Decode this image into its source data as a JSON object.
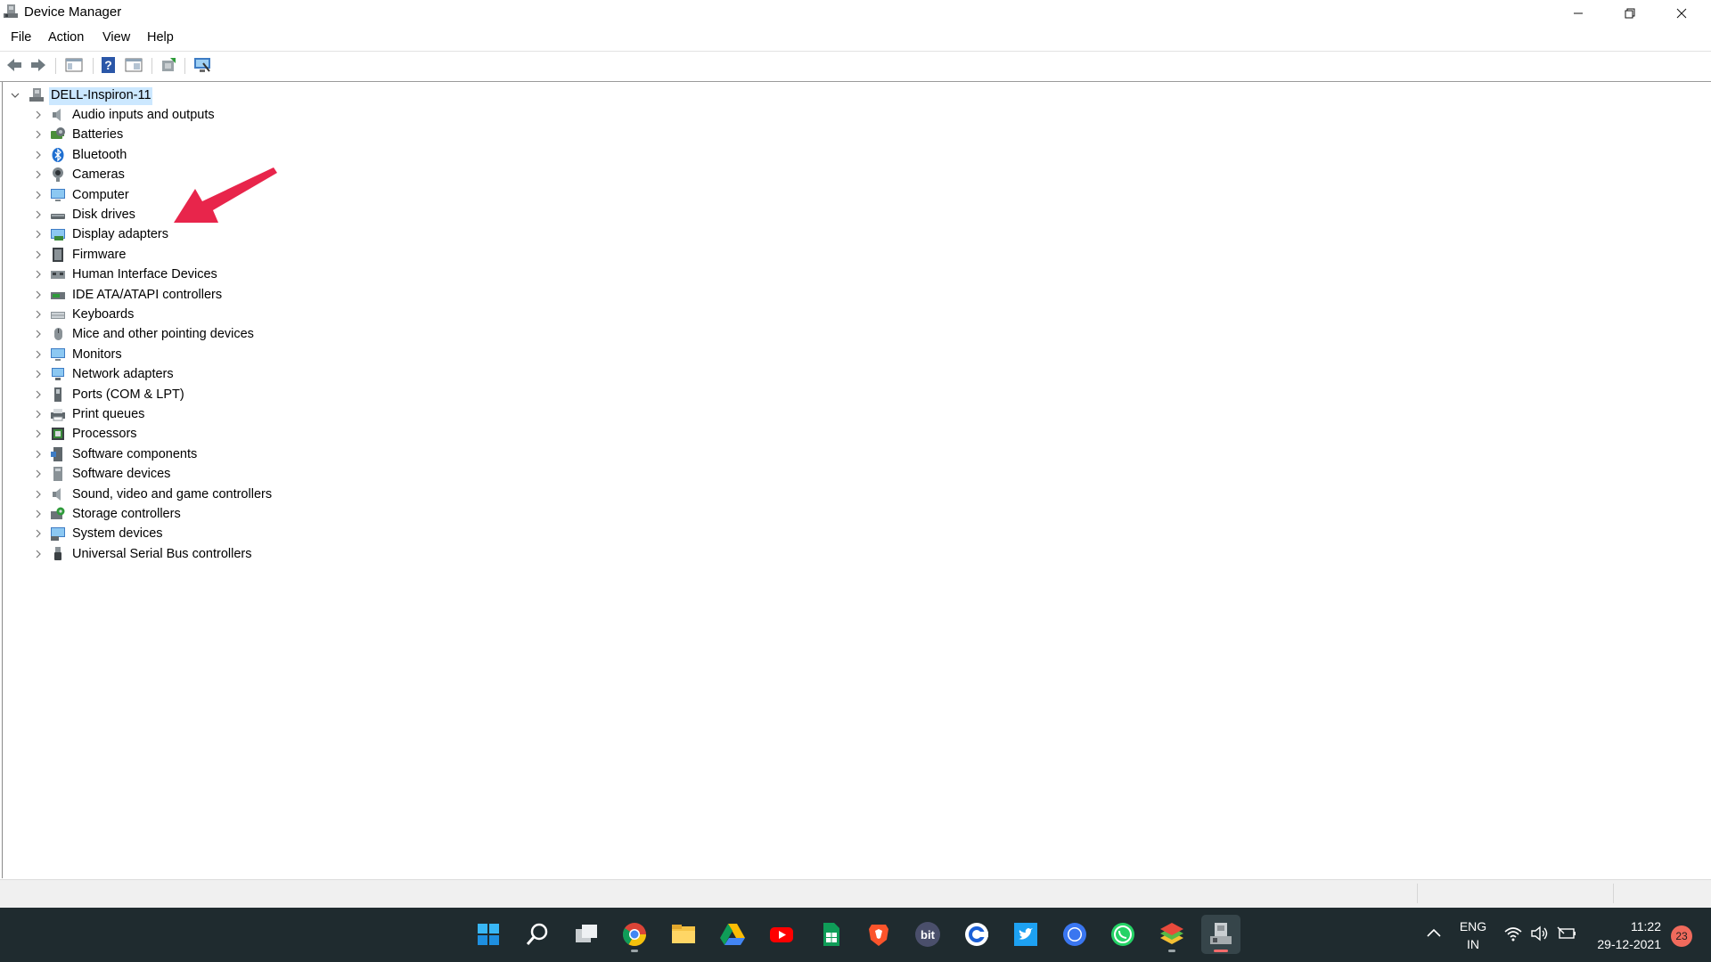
{
  "window": {
    "title": "Device Manager",
    "controls": [
      "minimize-icon",
      "restore-icon",
      "close-icon"
    ]
  },
  "menu": [
    "File",
    "Action",
    "View",
    "Help"
  ],
  "toolbar": {
    "buttons": [
      "back-icon",
      "forward-icon",
      "show-hide-console-tree-icon",
      "help-icon",
      "properties-icon",
      "update-driver-icon",
      "scan-hardware-icon"
    ]
  },
  "tree": {
    "root": "DELL-Inspiron-11",
    "items": [
      {
        "label": "Audio inputs and outputs",
        "icon": "speaker-icon"
      },
      {
        "label": "Batteries",
        "icon": "battery-icon"
      },
      {
        "label": "Bluetooth",
        "icon": "bluetooth-icon"
      },
      {
        "label": "Cameras",
        "icon": "camera-icon"
      },
      {
        "label": "Computer",
        "icon": "computer-icon"
      },
      {
        "label": "Disk drives",
        "icon": "disk-drive-icon"
      },
      {
        "label": "Display adapters",
        "icon": "display-adapter-icon"
      },
      {
        "label": "Firmware",
        "icon": "firmware-icon"
      },
      {
        "label": "Human Interface Devices",
        "icon": "hid-icon"
      },
      {
        "label": "IDE ATA/ATAPI controllers",
        "icon": "ide-controller-icon"
      },
      {
        "label": "Keyboards",
        "icon": "keyboard-icon"
      },
      {
        "label": "Mice and other pointing devices",
        "icon": "mouse-icon"
      },
      {
        "label": "Monitors",
        "icon": "monitor-icon"
      },
      {
        "label": "Network adapters",
        "icon": "network-adapter-icon"
      },
      {
        "label": "Ports (COM & LPT)",
        "icon": "port-icon"
      },
      {
        "label": "Print queues",
        "icon": "printer-icon"
      },
      {
        "label": "Processors",
        "icon": "processor-icon"
      },
      {
        "label": "Software components",
        "icon": "software-component-icon"
      },
      {
        "label": "Software devices",
        "icon": "software-device-icon"
      },
      {
        "label": "Sound, video and game controllers",
        "icon": "sound-controller-icon"
      },
      {
        "label": "Storage controllers",
        "icon": "storage-controller-icon"
      },
      {
        "label": "System devices",
        "icon": "system-device-icon"
      },
      {
        "label": "Universal Serial Bus controllers",
        "icon": "usb-icon"
      }
    ]
  },
  "annotation": {
    "icon": "red-arrow-icon",
    "color": "#e8254b"
  },
  "taskbar": {
    "apps": [
      {
        "name": "start-icon"
      },
      {
        "name": "search-icon"
      },
      {
        "name": "task-view-icon"
      },
      {
        "name": "chrome-icon",
        "running": true
      },
      {
        "name": "file-explorer-icon"
      },
      {
        "name": "google-drive-icon"
      },
      {
        "name": "youtube-icon"
      },
      {
        "name": "google-sheets-icon"
      },
      {
        "name": "brave-icon"
      },
      {
        "name": "bit-icon",
        "text": "bit"
      },
      {
        "name": "cortana-icon"
      },
      {
        "name": "twitter-icon"
      },
      {
        "name": "signal-icon"
      },
      {
        "name": "whatsapp-icon"
      },
      {
        "name": "bluestacks-icon",
        "running": true
      },
      {
        "name": "device-manager-taskbar-icon",
        "running": true,
        "active": true
      }
    ],
    "tray": {
      "language": "ENG",
      "region": "IN",
      "time": "11:22",
      "date": "29-12-2021",
      "notifications": "23"
    }
  },
  "colors": {
    "selection": "#cce8ff",
    "taskbar": "#1f2b2f",
    "accent": "#0078d7"
  }
}
